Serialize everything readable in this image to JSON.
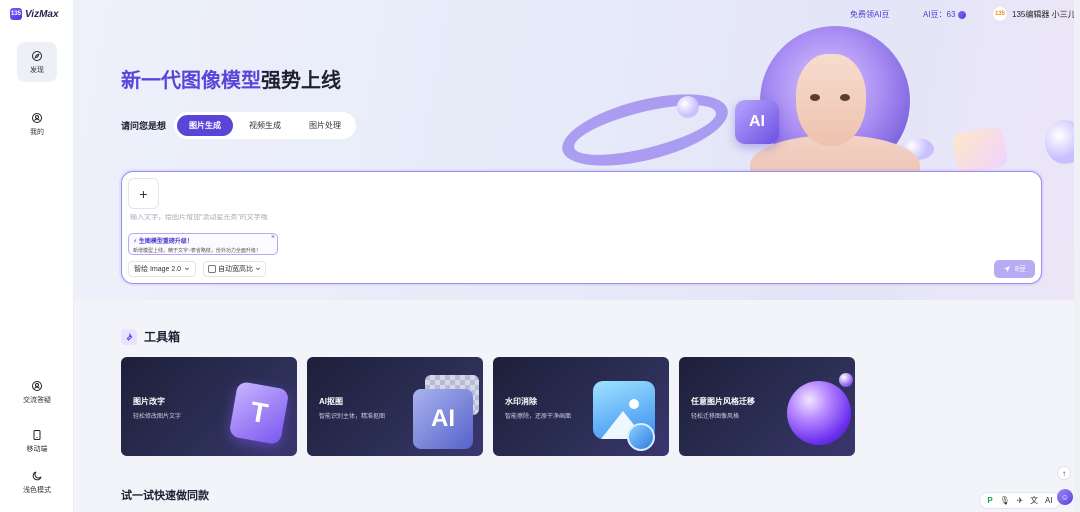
{
  "brand": {
    "logo_mark": "135",
    "name": "VizMax"
  },
  "sidebar": {
    "items": [
      {
        "label": "发现",
        "icon": "compass-icon",
        "active": true
      },
      {
        "label": "我的",
        "icon": "user-icon",
        "active": false
      }
    ],
    "bottom": [
      {
        "label": "交流答疑",
        "icon": "support-icon"
      },
      {
        "label": "移动端",
        "icon": "phone-icon"
      },
      {
        "label": "浅色模式",
        "icon": "moon-icon"
      }
    ]
  },
  "topbar": {
    "free_beans": "免费领AI豆",
    "beans_label": "AI豆：63",
    "avatar_text": "135",
    "user_name": "135编辑器 小三儿"
  },
  "hero": {
    "title_accent": "新一代图像模型",
    "title_rest": "强势上线",
    "ask_label": "请问您是想",
    "modes": [
      "图片生成",
      "视频生成",
      "图片处理"
    ],
    "active_mode": "图片生成",
    "illustration_badge": "AI"
  },
  "prompt": {
    "add_symbol": "+",
    "placeholder": "输入文字，给图片增加“流动星光类”的文字哦",
    "tip_title": "⚡ 生图模型重磅升级！",
    "tip_sub": "新增模型上线，精于文字~表省略枝，份外功力全面升级！",
    "tip_close": "×",
    "model": "智绘 Image 2.0",
    "ratio_label": "自动宽高比",
    "send_label": "8豆"
  },
  "toolbox": {
    "title": "工具箱",
    "cards": [
      {
        "title": "图片改字",
        "sub": "轻松修改图片文字",
        "art": "T"
      },
      {
        "title": "AI抠图",
        "sub": "智能识别主体，精准抠图",
        "art": "AI"
      },
      {
        "title": "水印消除",
        "sub": "智能擦除，还原干净画面",
        "art": "image-icon"
      },
      {
        "title": "任意图片风格迁移",
        "sub": "轻松迁移图像风格",
        "art": "sphere"
      }
    ]
  },
  "try_section": {
    "title": "试一试快速做同款"
  },
  "float_bar": {
    "items": [
      "P",
      "🎙",
      "✈",
      "文",
      "AI"
    ],
    "scroll_top": "↑",
    "chat": "☺"
  }
}
